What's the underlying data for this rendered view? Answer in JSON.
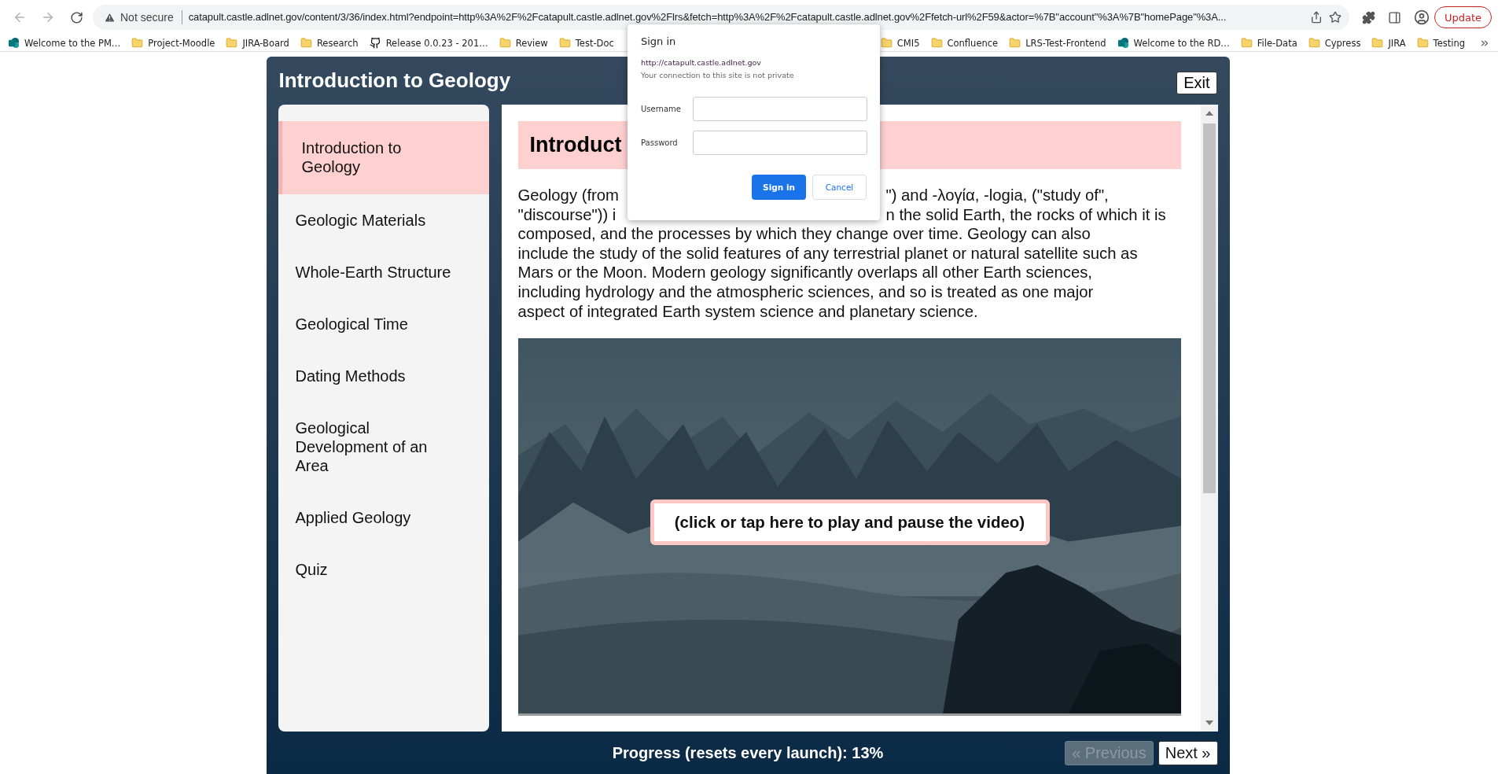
{
  "browser": {
    "security_label": "Not secure",
    "url": "catapult.castle.adlnet.gov/content/3/36/index.html?endpoint=http%3A%2F%2Fcatapult.castle.adlnet.gov%2Flrs&fetch=http%3A%2F%2Fcatapult.castle.adlnet.gov%2Ffetch-url%2F59&actor=%7B\"account\"%3A%7B\"homePage\"%3A...",
    "update_button": "Update"
  },
  "bookmarks": {
    "left": [
      {
        "kind": "site",
        "label": "Welcome to the PM…"
      },
      {
        "kind": "folder",
        "label": "Project-Moodle"
      },
      {
        "kind": "folder",
        "label": "JIRA-Board"
      },
      {
        "kind": "folder",
        "label": "Research"
      },
      {
        "kind": "github",
        "label": "Release 0.0.23 - 201…"
      },
      {
        "kind": "folder",
        "label": "Review"
      },
      {
        "kind": "folder",
        "label": "Test-Doc"
      }
    ],
    "right": [
      {
        "kind": "folder",
        "label": "CMI5"
      },
      {
        "kind": "folder",
        "label": "Confluence"
      },
      {
        "kind": "folder",
        "label": "LRS-Test-Frontend"
      },
      {
        "kind": "site",
        "label": "Welcome to the RD…"
      },
      {
        "kind": "folder",
        "label": "File-Data"
      },
      {
        "kind": "folder",
        "label": "Cypress"
      },
      {
        "kind": "folder",
        "label": "JIRA"
      },
      {
        "kind": "folder",
        "label": "Testing"
      }
    ]
  },
  "course": {
    "title": "Introduction to Geology",
    "exit": "Exit",
    "sidebar": [
      {
        "label": "Introduction to Geology",
        "selected": true
      },
      {
        "label": "Geologic Materials",
        "selected": false
      },
      {
        "label": "Whole-Earth Structure",
        "selected": false
      },
      {
        "label": "Geological Time",
        "selected": false
      },
      {
        "label": "Dating Methods",
        "selected": false
      },
      {
        "label": "Geological Development of an Area",
        "selected": false
      },
      {
        "label": "Applied Geology",
        "selected": false
      },
      {
        "label": "Quiz",
        "selected": false
      }
    ],
    "heading": "Introduct",
    "paragraph": [
      {
        "kind": "split",
        "left": "Geology (from",
        "right": "\") and -λογία, -logia, (\"study of\","
      },
      {
        "kind": "split",
        "left": "\"discourse\")) i",
        "right": "n the solid Earth, the rocks of which it is"
      },
      {
        "kind": "full",
        "text": "composed, and the processes by which they change over time. Geology can also"
      },
      {
        "kind": "full",
        "text": "include the study of the solid features of any terrestrial planet or natural satellite such as"
      },
      {
        "kind": "full",
        "text": "Mars or the Moon. Modern geology significantly overlaps all other Earth sciences,"
      },
      {
        "kind": "full",
        "text": "including hydrology and the atmospheric sciences, and so is treated as one major"
      },
      {
        "kind": "full",
        "text": "aspect of integrated Earth system science and planetary science."
      }
    ],
    "video": {
      "kind": "picture",
      "overlay": "(click or tap here to play and pause the video)"
    },
    "progress": "Progress (resets every launch): 13%",
    "previous": {
      "label": "« Previous",
      "disabled": true
    },
    "next": {
      "label": "Next »",
      "disabled": false
    }
  },
  "dialog": {
    "title": "Sign in",
    "origin": "http://catapult.castle.adlnet.gov",
    "warning": "Your connection to this site is not private",
    "fields": [
      {
        "label": "Username"
      },
      {
        "label": "Password"
      }
    ],
    "primary": "Sign in",
    "secondary": "Cancel"
  }
}
